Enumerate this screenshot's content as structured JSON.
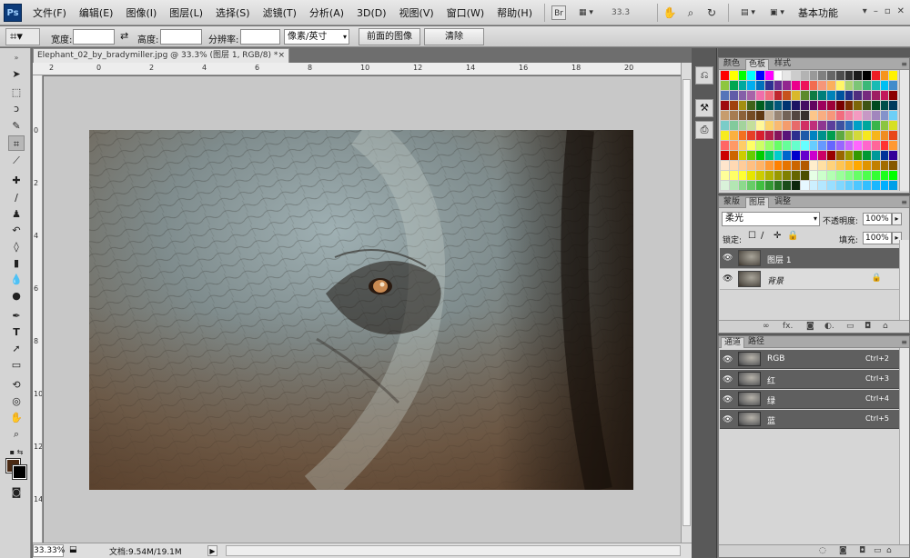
{
  "app": {
    "logo": "Ps",
    "menu": [
      "文件(F)",
      "编辑(E)",
      "图像(I)",
      "图层(L)",
      "选择(S)",
      "滤镜(T)",
      "分析(A)",
      "3D(D)",
      "视图(V)",
      "窗口(W)",
      "帮助(H)"
    ],
    "bridge_label": "Br",
    "zoom_display": "33.3",
    "workspace_label": "基本功能",
    "win_buttons": [
      "▾",
      "–",
      "▫",
      "✕"
    ]
  },
  "options_bar": {
    "tool_icon": "⌗▾",
    "width_label": "宽度:",
    "swap_icon": "⇄",
    "height_label": "高度:",
    "resolution_label": "分辨率:",
    "unit_select": "像素/英寸",
    "front_image_button": "前面的图像",
    "clear_button": "清除"
  },
  "document": {
    "tab_title": "Elephant_02_by_bradymiller.jpg @ 33.3% (图层 1, RGB/8) *",
    "tab_close": "×",
    "ruler_top_labels": [
      "2",
      "0",
      "2",
      "4",
      "6",
      "8",
      "10",
      "12",
      "14",
      "16",
      "18",
      "20"
    ],
    "ruler_left_labels": [
      "0",
      "2",
      "4",
      "6",
      "8",
      "10",
      "12",
      "14"
    ]
  },
  "status": {
    "zoom": "33.33%",
    "doc_size": "文档:9.54M/19.1M",
    "arrow": "▶"
  },
  "swatches_panel": {
    "tabs": [
      "颜色",
      "色板",
      "样式"
    ],
    "active_tab": "色板",
    "colors": [
      "#ff0000",
      "#ffff00",
      "#00ff00",
      "#00ffff",
      "#0000ff",
      "#ff00ff",
      "#ffffff",
      "#e6e6e6",
      "#cccccc",
      "#b3b3b3",
      "#999999",
      "#808080",
      "#666666",
      "#4d4d4d",
      "#333333",
      "#1a1a1a",
      "#000000",
      "#ed1c24",
      "#f7941d",
      "#fff200",
      "#8dc63f",
      "#00a651",
      "#00a99d",
      "#00aeef",
      "#0072bc",
      "#2e3192",
      "#662d91",
      "#92278f",
      "#ec008c",
      "#ed145b",
      "#f26c4f",
      "#f69679",
      "#fbaf5d",
      "#fff568",
      "#acd373",
      "#7cc576",
      "#3bb878",
      "#1abbb4",
      "#00bff3",
      "#438ccb",
      "#5674b9",
      "#605ca8",
      "#855fa8",
      "#a763a8",
      "#f06eaa",
      "#f26d7d",
      "#c1272d",
      "#c7531c",
      "#d9b82b",
      "#5c8a2b",
      "#0f7b44",
      "#007f7a",
      "#0083b8",
      "#00549f",
      "#21328b",
      "#4f2d7f",
      "#762a7f",
      "#9e1f63",
      "#c2185b",
      "#8b0000",
      "#9e0b0f",
      "#a0410d",
      "#a38f12",
      "#40631a",
      "#005e20",
      "#005952",
      "#00587c",
      "#003471",
      "#1b1464",
      "#440e62",
      "#630460",
      "#9e005d",
      "#9e0039",
      "#790000",
      "#7b2e00",
      "#7d6608",
      "#3d5515",
      "#004a1e",
      "#004e4a",
      "#003b5c",
      "#c69c6d",
      "#a67c52",
      "#8c6239",
      "#754c24",
      "#603913",
      "#c7b299",
      "#998675",
      "#736357",
      "#534741",
      "#362f2d",
      "#fdc689",
      "#f9ad81",
      "#f7977a",
      "#f26c7e",
      "#f282a3",
      "#f49ac1",
      "#c798c5",
      "#a286bd",
      "#8493ca",
      "#6dcff6",
      "#7accc8",
      "#82ca9c",
      "#a3d39c",
      "#c4df9b",
      "#fff799",
      "#fbd36b",
      "#f9b970",
      "#f49c6c",
      "#e76a6a",
      "#d12f63",
      "#bf2f7b",
      "#8e3691",
      "#5b3f9c",
      "#3d52a1",
      "#2b6ebd",
      "#00a0c6",
      "#00a79d",
      "#39b54a",
      "#8bc53f",
      "#d7df23",
      "#f8eb20",
      "#fbb040",
      "#f37021",
      "#e73e26",
      "#d71f2f",
      "#b31f48",
      "#86155c",
      "#59157a",
      "#2d2f8f",
      "#1f5aa8",
      "#0083c1",
      "#00918c",
      "#009e4f",
      "#5ea941",
      "#a4c83a",
      "#d3d93a",
      "#f6e81e",
      "#f6b51c",
      "#f08d20",
      "#e8471a",
      "#ff6666",
      "#ff9966",
      "#ffcc66",
      "#ffff66",
      "#ccff66",
      "#99ff66",
      "#66ff66",
      "#66ff99",
      "#66ffcc",
      "#66ffff",
      "#66ccff",
      "#6699ff",
      "#6666ff",
      "#9966ff",
      "#cc66ff",
      "#ff66ff",
      "#ff66cc",
      "#ff6699",
      "#ff3333",
      "#ff9933",
      "#cc0000",
      "#cc6600",
      "#cccc00",
      "#66cc00",
      "#00cc00",
      "#00cc66",
      "#00cccc",
      "#0066cc",
      "#0000cc",
      "#6600cc",
      "#cc00cc",
      "#cc0066",
      "#990000",
      "#996600",
      "#999900",
      "#339900",
      "#009933",
      "#009999",
      "#003399",
      "#330099",
      "#ffe5cc",
      "#ffd9b3",
      "#ffcc99",
      "#ffbf80",
      "#ffb366",
      "#ff9933",
      "#ff8000",
      "#e67300",
      "#cc6600",
      "#b35900",
      "#ffeecc",
      "#ffe0a3",
      "#ffd27a",
      "#ffc452",
      "#ffb629",
      "#ffa800",
      "#e09400",
      "#c28000",
      "#a36c00",
      "#855800",
      "#ffff99",
      "#ffff66",
      "#ffff33",
      "#e6e600",
      "#cccc00",
      "#b3b300",
      "#999900",
      "#808000",
      "#666600",
      "#4d4d00",
      "#e6ffe6",
      "#ccffcc",
      "#b3ffb3",
      "#99ff99",
      "#80ff80",
      "#66ff66",
      "#4dff4d",
      "#33ff33",
      "#1aff1a",
      "#00ff00",
      "#d9f2d9",
      "#b3e6b3",
      "#8cd98c",
      "#66cc66",
      "#40bf40",
      "#339933",
      "#267326",
      "#1a4d1a",
      "#0d260d",
      "#e6f7ff",
      "#ccefff",
      "#b3e7ff",
      "#99dfff",
      "#80d7ff",
      "#66cfff",
      "#4dc7ff",
      "#33bfff",
      "#1ab7ff",
      "#00afff",
      "#009fe8"
    ]
  },
  "layers_panel": {
    "tabs": [
      "蒙版",
      "图层",
      "调整"
    ],
    "active_tab": "图层",
    "blend_mode": "柔光",
    "opacity_label": "不透明度:",
    "opacity_value": "100%",
    "lock_label": "锁定:",
    "fill_label": "填充:",
    "fill_value": "100%",
    "layers": [
      {
        "name": "图层 1",
        "selected": true
      },
      {
        "name": "背景",
        "selected": false,
        "locked": true
      }
    ],
    "footer_icons": [
      "∞",
      "fx.",
      "◙",
      "◐.",
      "▭",
      "◘",
      "⌂"
    ]
  },
  "channels_panel": {
    "tabs": [
      "通道",
      "路径"
    ],
    "active_tab": "通道",
    "channels": [
      {
        "name": "RGB",
        "shortcut": "Ctrl+2"
      },
      {
        "name": "红",
        "shortcut": "Ctrl+3"
      },
      {
        "name": "绿",
        "shortcut": "Ctrl+4"
      },
      {
        "name": "蓝",
        "shortcut": "Ctrl+5"
      }
    ],
    "footer_icons": [
      "◌",
      "◙",
      "◘",
      "▭",
      "⌂"
    ]
  }
}
